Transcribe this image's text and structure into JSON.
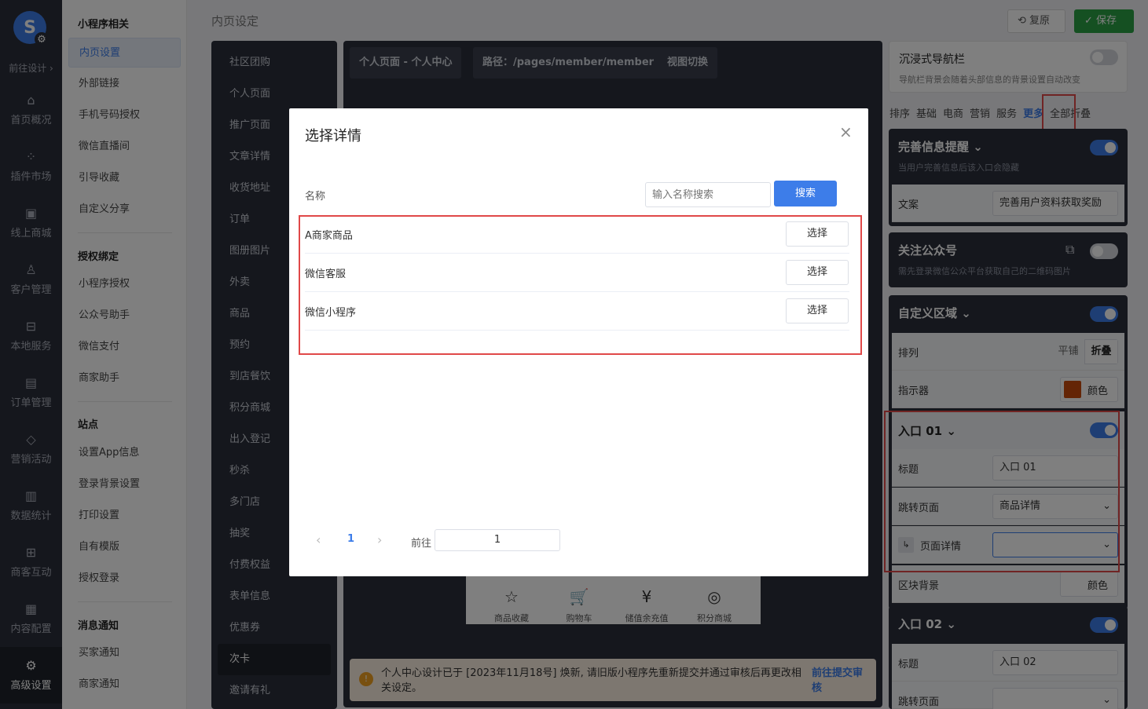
{
  "leftnav": {
    "goto_label": "前往设计 ›",
    "items": [
      {
        "label": "首页概况",
        "icon": "home-icon"
      },
      {
        "label": "插件市场",
        "icon": "plugins-icon"
      },
      {
        "label": "线上商城",
        "icon": "shop-icon"
      },
      {
        "label": "客户管理",
        "icon": "user-icon"
      },
      {
        "label": "本地服务",
        "icon": "store-icon"
      },
      {
        "label": "订单管理",
        "icon": "order-icon"
      },
      {
        "label": "营销活动",
        "icon": "diamond-icon"
      },
      {
        "label": "数据统计",
        "icon": "stats-icon"
      },
      {
        "label": "商客互动",
        "icon": "interact-icon"
      },
      {
        "label": "内容配置",
        "icon": "content-icon"
      },
      {
        "label": "高级设置",
        "icon": "gear-icon"
      }
    ]
  },
  "subnav": {
    "group1": "小程序相关",
    "g1": [
      "内页设置",
      "外部链接",
      "手机号码授权",
      "微信直播间",
      "引导收藏",
      "自定义分享"
    ],
    "group2": "授权绑定",
    "g2": [
      "小程序授权",
      "公众号助手",
      "微信支付",
      "商家助手"
    ],
    "group3": "站点",
    "g3": [
      "设置App信息",
      "登录背景设置",
      "打印设置",
      "自有模版",
      "授权登录"
    ],
    "group4": "消息通知",
    "g4": [
      "买家通知",
      "商家通知"
    ]
  },
  "header": {
    "title": "内页设定",
    "restore": "复原",
    "save": "保存"
  },
  "pagelist": [
    "社区团购",
    "个人页面",
    "推广页面",
    "文章详情",
    "收货地址",
    "订单",
    "图册图片",
    "外卖",
    "商品",
    "预约",
    "到店餐饮",
    "积分商城",
    "出入登记",
    "秒杀",
    "多门店",
    "抽奖",
    "付费权益",
    "表单信息",
    "优惠券",
    "次卡",
    "邀请有礼"
  ],
  "canvas": {
    "chip1": "个人页面 - 个人中心",
    "chip2": "路径：/pages/member/member",
    "chip3": "视图切换",
    "phone_icons": [
      {
        "label": "商品收藏",
        "glyph": "☆"
      },
      {
        "label": "购物车",
        "glyph": "🛒"
      },
      {
        "label": "储值余充值",
        "glyph": "¥"
      },
      {
        "label": "积分商城",
        "glyph": "◎"
      }
    ],
    "notice": "个人中心设计已于 [2023年11月18号] 焕新, 请旧版小程序先重新提交并通过审核后再更改相关设定。",
    "notice_link": "前往提交审核"
  },
  "right": {
    "immersive_title": "沉浸式导航栏",
    "immersive_sub": "导航栏背景会随着头部信息的背景设置自动改变",
    "tabs": [
      "排序",
      "基础",
      "电商",
      "营销",
      "服务",
      "更多",
      "全部折叠"
    ],
    "remind_title": "完善信息提醒",
    "remind_sub": "当用户完善信息后该入口会隐藏",
    "copy_label": "文案",
    "copy_value": "完善用户资料获取奖励",
    "follow_title": "关注公众号",
    "follow_sub": "需先登录微信公众平台获取自己的二维码图片",
    "custom_title": "自定义区域",
    "arrange_label": "排列",
    "arrange_opt1": "平铺",
    "arrange_opt2": "折叠",
    "indicator_label": "指示器",
    "color_label": "颜色",
    "indicator_color": "#c94a0c",
    "entry1_title": "入口 01",
    "title_label": "标题",
    "entry1_value": "入口 01",
    "jump_label": "跳转页面",
    "jump_value": "商品详情",
    "detail_label": "页面详情",
    "bg_label": "区块背景",
    "bg_color_label": "颜色",
    "entry2_title": "入口 02",
    "entry2_value": "入口 02",
    "jump2_label": "跳转页面"
  },
  "modal": {
    "title": "选择详情",
    "name_label": "名称",
    "search_placeholder": "输入名称搜索",
    "search_btn": "搜索",
    "rows": [
      {
        "name": "A商家商品",
        "action": "选择"
      },
      {
        "name": "微信客服",
        "action": "选择"
      },
      {
        "name": "微信小程序",
        "action": "选择"
      }
    ],
    "page_current": "1",
    "goto_label": "前往",
    "goto_value": "1"
  },
  "colors": {
    "accent": "#3d7de9",
    "save": "#2aa044",
    "highlight": "#e04848"
  }
}
